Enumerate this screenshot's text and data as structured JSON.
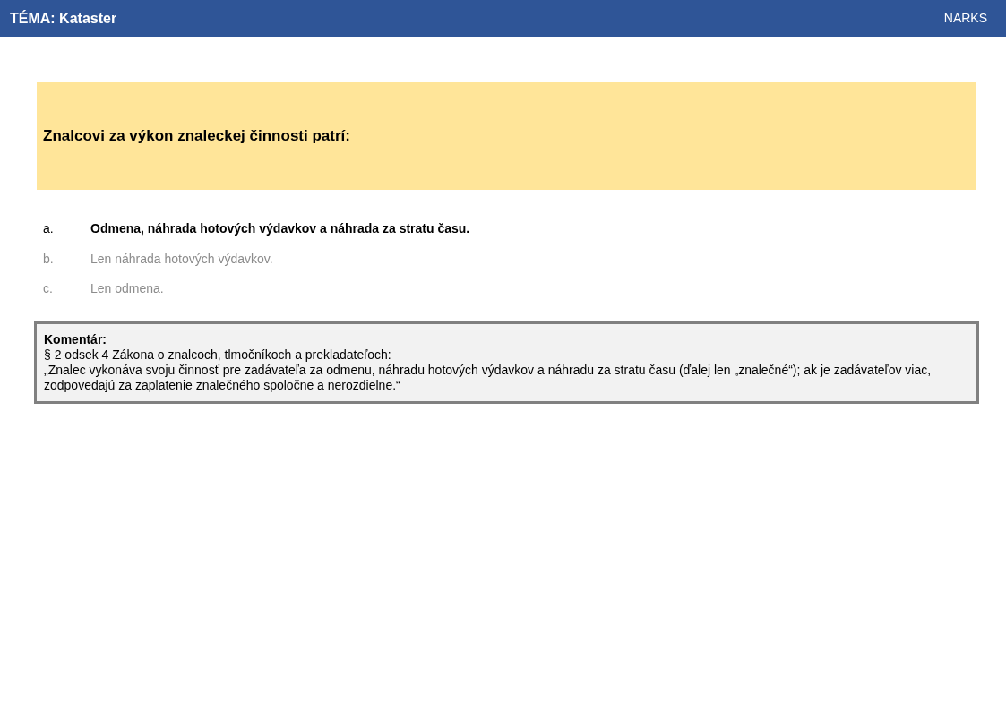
{
  "header": {
    "title": "TÉMA: Kataster",
    "brand": "NARKS"
  },
  "question": "Znalcovi za výkon znaleckej činnosti patrí:",
  "answers": [
    {
      "letter": "a.",
      "text": "Odmena, náhrada hotových výdavkov a náhrada za stratu času.",
      "correct": true
    },
    {
      "letter": "b.",
      "text": "Len náhrada hotových výdavkov.",
      "correct": false
    },
    {
      "letter": "c.",
      "text": "Len odmena.",
      "correct": false
    }
  ],
  "comment": {
    "heading": "Komentár:",
    "lines": [
      "§ 2 odsek 4 Zákona o znalcoch, tlmočníkoch a prekladateľoch:",
      "„Znalec vykonáva svoju činnosť pre zadávateľa za odmenu, náhradu hotových výdavkov a náhradu za stratu času (ďalej len „znalečné“); ak je zadávateľov viac, zodpovedajú za zaplatenie znalečného spoločne a nerozdielne.“"
    ]
  }
}
